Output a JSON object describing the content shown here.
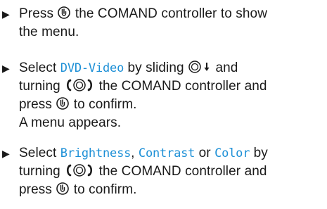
{
  "steps": [
    {
      "lines": [
        {
          "parts": [
            {
              "t": "Press "
            },
            {
              "icon": "press-controller-icon"
            },
            {
              "t": " the COMAND controller to show"
            }
          ]
        },
        {
          "parts": [
            {
              "t": "the menu."
            }
          ]
        }
      ]
    },
    {
      "lines": [
        {
          "parts": [
            {
              "t": "Select "
            },
            {
              "kw": "DVD-Video"
            },
            {
              "t": " by sliding "
            },
            {
              "icon": "slide-down-icon"
            },
            {
              "t": " and"
            }
          ]
        },
        {
          "parts": [
            {
              "t": "turning "
            },
            {
              "icon": "turn-controller-icon"
            },
            {
              "t": " the COMAND controller and"
            }
          ]
        },
        {
          "parts": [
            {
              "t": "press "
            },
            {
              "icon": "press-controller-icon"
            },
            {
              "t": " to confirm."
            }
          ]
        },
        {
          "parts": [
            {
              "t": "A menu appears."
            }
          ]
        }
      ]
    },
    {
      "lines": [
        {
          "parts": [
            {
              "t": "Select "
            },
            {
              "kw": "Brightness"
            },
            {
              "t": ", "
            },
            {
              "kw": "Contrast"
            },
            {
              "t": " or "
            },
            {
              "kw": "Color"
            },
            {
              "t": " by"
            }
          ]
        },
        {
          "parts": [
            {
              "t": "turning "
            },
            {
              "icon": "turn-controller-icon"
            },
            {
              "t": " the COMAND controller and"
            }
          ]
        },
        {
          "parts": [
            {
              "t": "press "
            },
            {
              "icon": "press-controller-icon"
            },
            {
              "t": " to confirm."
            }
          ]
        }
      ]
    }
  ],
  "bullet_glyph": "▶",
  "keyword_color": "#1c8fd6"
}
